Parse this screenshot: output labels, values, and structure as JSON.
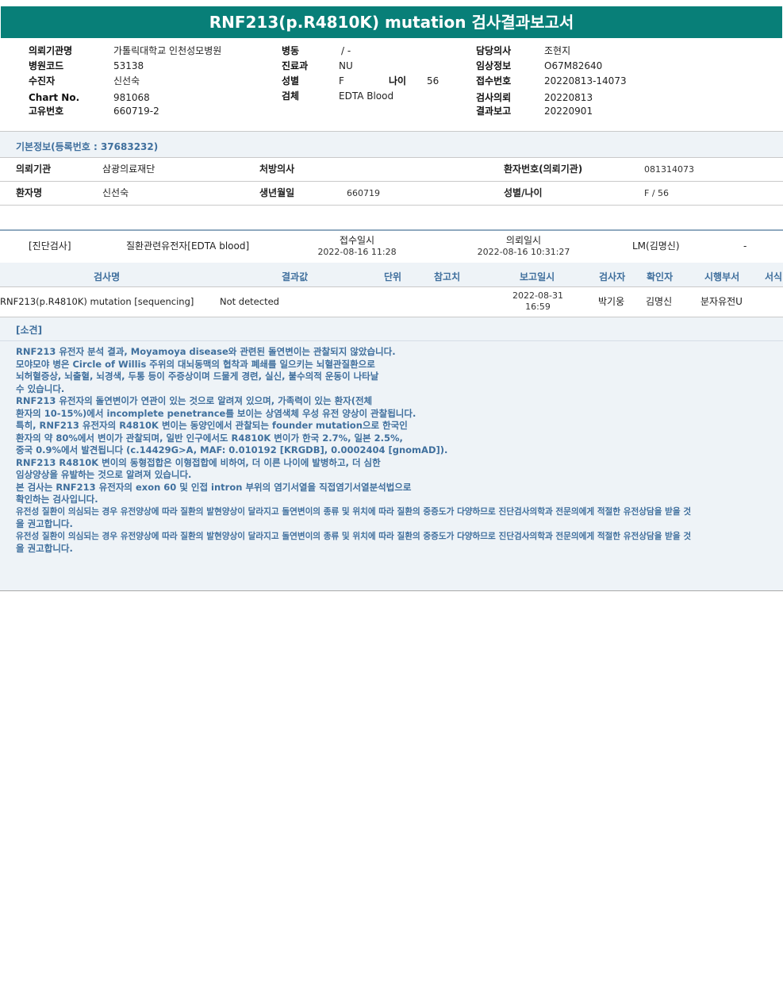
{
  "title": "RNF213(p.R4810K) mutation 검사결과보고서",
  "header": {
    "col1": [
      {
        "label": "의뢰기관명",
        "value": "가톨릭대학교 인천성모병원"
      },
      {
        "label": "병원코드",
        "value": "53138"
      },
      {
        "label": "수진자",
        "value": "신선숙"
      },
      {
        "label": "Chart No.",
        "value": "981068"
      },
      {
        "label": "고유번호",
        "value": "660719-2"
      }
    ],
    "col2": [
      {
        "label": "병동",
        "value": "/ -"
      },
      {
        "label": "진료과",
        "value": "NU"
      },
      {
        "label": "성별",
        "value": "F"
      },
      {
        "label": "검체",
        "value": "EDTA Blood"
      }
    ],
    "age": {
      "label": "나이",
      "value": "56"
    },
    "col3": [
      {
        "label": "담당의사",
        "value": "조현지"
      },
      {
        "label": "임상정보",
        "value": "O67M82640"
      },
      {
        "label": "접수번호",
        "value": "20220813-14073"
      },
      {
        "label": "검사의뢰",
        "value": "20220813"
      },
      {
        "label": "결과보고",
        "value": "20220901"
      }
    ]
  },
  "basic": {
    "section_title": "기본정보(등록번호 : 37683232)",
    "row1": {
      "inst_label": "의뢰기관",
      "inst_value": "삼광의료재단",
      "doctor_label": "처방의사",
      "doctor_value": "",
      "patno_label": "환자번호(의뢰기관)",
      "patno_value": "081314073"
    },
    "row2": {
      "name_label": "환자명",
      "name_value": "신선숙",
      "dob_label": "생년월일",
      "dob_value": "660719",
      "sexage_label": "성별/나이",
      "sexage_value": "F / 56"
    }
  },
  "exam": {
    "category": "[진단검사]",
    "item": "질환관련유전자[EDTA blood]",
    "received_label": "접수일시",
    "received_value": "2022-08-16  11:28",
    "requested_label": "의뢰일시",
    "requested_value": "2022-08-16  10:31:27",
    "lm": "LM(김명신)",
    "dash": "-"
  },
  "table": {
    "headers": [
      "검사명",
      "결과값",
      "단위",
      "참고치",
      "보고일시",
      "검사자",
      "확인자",
      "시행부서",
      "서식"
    ],
    "row": {
      "name": "RNF213(p.R4810K) mutation [sequencing]",
      "result": "Not detected",
      "unit": "",
      "ref": "",
      "report_date": "2022-08-31",
      "report_time": "16:59",
      "tester": "박기웅",
      "confirmer": "김명신",
      "dept": "분자유전U"
    }
  },
  "comment": {
    "title": "[소견]",
    "lines": [
      "RNF213 유전자 분석 결과, Moyamoya disease와 관련된 돌연변이는 관찰되지 않았습니다.",
      "",
      "모야모야 병은 Circle of Willis 주위의 대뇌동맥의 협착과 폐쇄를 일으키는 뇌혈관질환으로",
      "뇌허혈증상, 뇌출혈, 뇌경색, 두통 등이 주증상이며 드물게 경련, 실신, 불수의적 운동이 나타날",
      "수 있습니다.",
      "RNF213 유전자의 돌연변이가 연관이 있는 것으로 알려져 있으며, 가족력이 있는 환자(전체",
      "환자의 10-15%)에서 incomplete penetrance를 보이는 상염색체 우성 유전 양상이 관찰됩니다.",
      "특히, RNF213 유전자의 R4810K 변이는 동양인에서 관찰되는 founder mutation으로 한국인",
      "환자의 약 80%에서 변이가 관찰되며, 일반 인구에서도 R4810K 변이가 한국 2.7%, 일본 2.5%,",
      "중국 0.9%에서 발견됩니다 (c.14429G>A, MAF: 0.010192 [KRGDB], 0.0002404 [gnomAD]).",
      "RNF213 R4810K 변이의 동형접합은 이형접합에 비하여, 더 이른 나이에 발병하고, 더 심한",
      "임상양상을 유발하는 것으로 알려져 있습니다.",
      "",
      "본 검사는 RNF213 유전자의 exon 60 및 인접 intron 부위의 염기서열을 직접염기서열분석법으로",
      "확인하는 검사입니다.",
      "유전성 질환이 의심되는 경우 유전양상에 따라 질환의 발현양상이 달라지고 돌연변이의 종류 및 위치에 따라 질환의 중증도가 다양하므로 진단검사의학과 전문의에게 적절한 유전상담을 받을 것",
      "을 권고합니다.",
      "유전성 질환이 의심되는 경우 유전양상에 따라 질환의 발현양상이 달라지고 돌연변이의 종류 및 위치에 따라 질환의 중증도가 다양하므로 진단검사의학과 전문의에게 적절한 유전상담을 받을 것",
      "을 권고합니다."
    ]
  }
}
